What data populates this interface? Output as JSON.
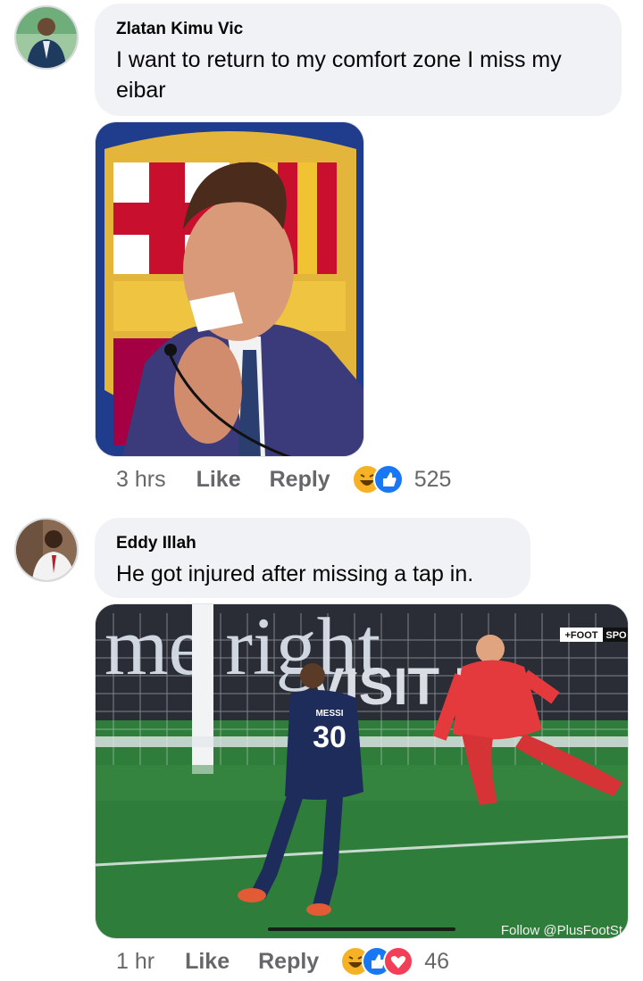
{
  "comments": [
    {
      "author": "Zlatan Kimu Vic",
      "text_line1": "I want to return to my comfort zone I miss my",
      "text_line2": "eibar",
      "time": "3 hrs",
      "like_label": "Like",
      "reply_label": "Reply",
      "reaction_count": "525",
      "reactions": [
        "haha-icon",
        "like-icon"
      ],
      "media_icon": "crying-player-photo"
    },
    {
      "author": "Eddy Illah",
      "text_line1": "He got injured after missing a tap in.",
      "time": "1 hr",
      "like_label": "Like",
      "reply_label": "Reply",
      "reaction_count": "46",
      "reactions": [
        "haha-icon",
        "like-icon",
        "love-icon"
      ],
      "media_icon": "football-penalty-photo",
      "overlay": {
        "board_text": "me right",
        "board_text2": "VISIT R",
        "badge_left": "+FOOT",
        "badge_right": "SPO",
        "shirt_name": "MESSI",
        "shirt_number": "30",
        "watermark": "Follow @PlusFootSt"
      }
    }
  ],
  "colors": {
    "bubble": "#f0f2f5",
    "meta_text": "#65676b",
    "like_blue": "#1877f2",
    "love_red": "#f33e58",
    "haha_yellow": "#f7b125"
  }
}
